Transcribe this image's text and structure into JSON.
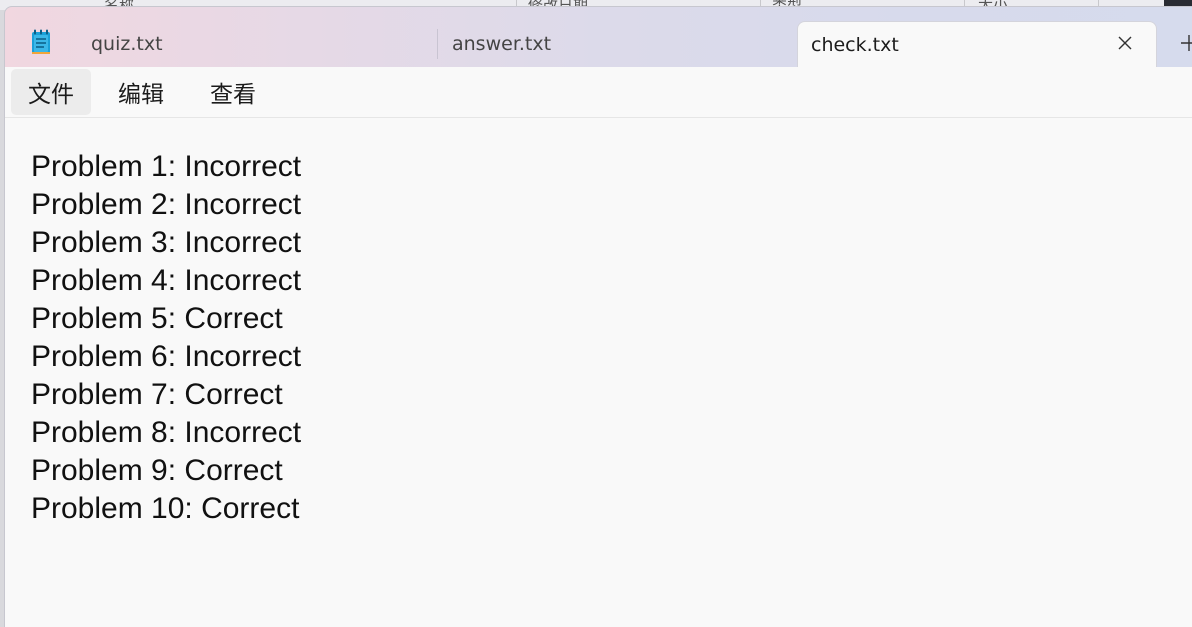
{
  "background_header": {
    "columns": [
      "名称",
      "修改日期",
      "类型",
      "大小"
    ]
  },
  "tabs": [
    {
      "label": "quiz.txt",
      "active": false
    },
    {
      "label": "answer.txt",
      "active": false
    },
    {
      "label": "check.txt",
      "active": true
    }
  ],
  "icons": {
    "app": "notepad-icon",
    "close": "close-icon",
    "new_tab": "plus-icon"
  },
  "menu": {
    "file": "文件",
    "edit": "编辑",
    "view": "查看"
  },
  "content": {
    "lines": [
      "Problem 1: Incorrect",
      "Problem 2: Incorrect",
      "Problem 3: Incorrect",
      "Problem 4: Incorrect",
      "Problem 5: Correct",
      "Problem 6: Incorrect",
      "Problem 7: Correct",
      "Problem 8: Incorrect",
      "Problem 9: Correct",
      "Problem 10: Correct"
    ]
  },
  "colors": {
    "accent": "#1aa0d8",
    "editor_bg": "#f9f9f9",
    "text": "#111111"
  }
}
